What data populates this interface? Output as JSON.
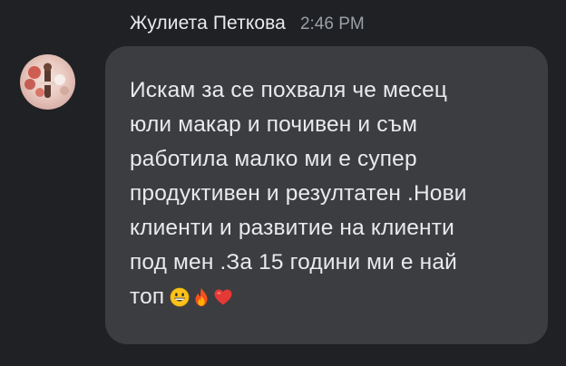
{
  "message": {
    "sender_name": "Жулиета Петкова",
    "timestamp": "2:46 PM",
    "text": "Искам за се похваля че месец\nюли макар и почивен и съм\nработила малко ми е супер\nпродуктивен и резултатен .Нови\nклиенти и развитие на клиенти\nпод мен .За 15 години ми е най\nтоп",
    "emojis": [
      "grinning-face",
      "fire",
      "red-heart"
    ]
  },
  "colors": {
    "background": "#202124",
    "bubble": "#3c3d40",
    "text": "#e8eaed",
    "timestamp": "#9aa0a6"
  }
}
